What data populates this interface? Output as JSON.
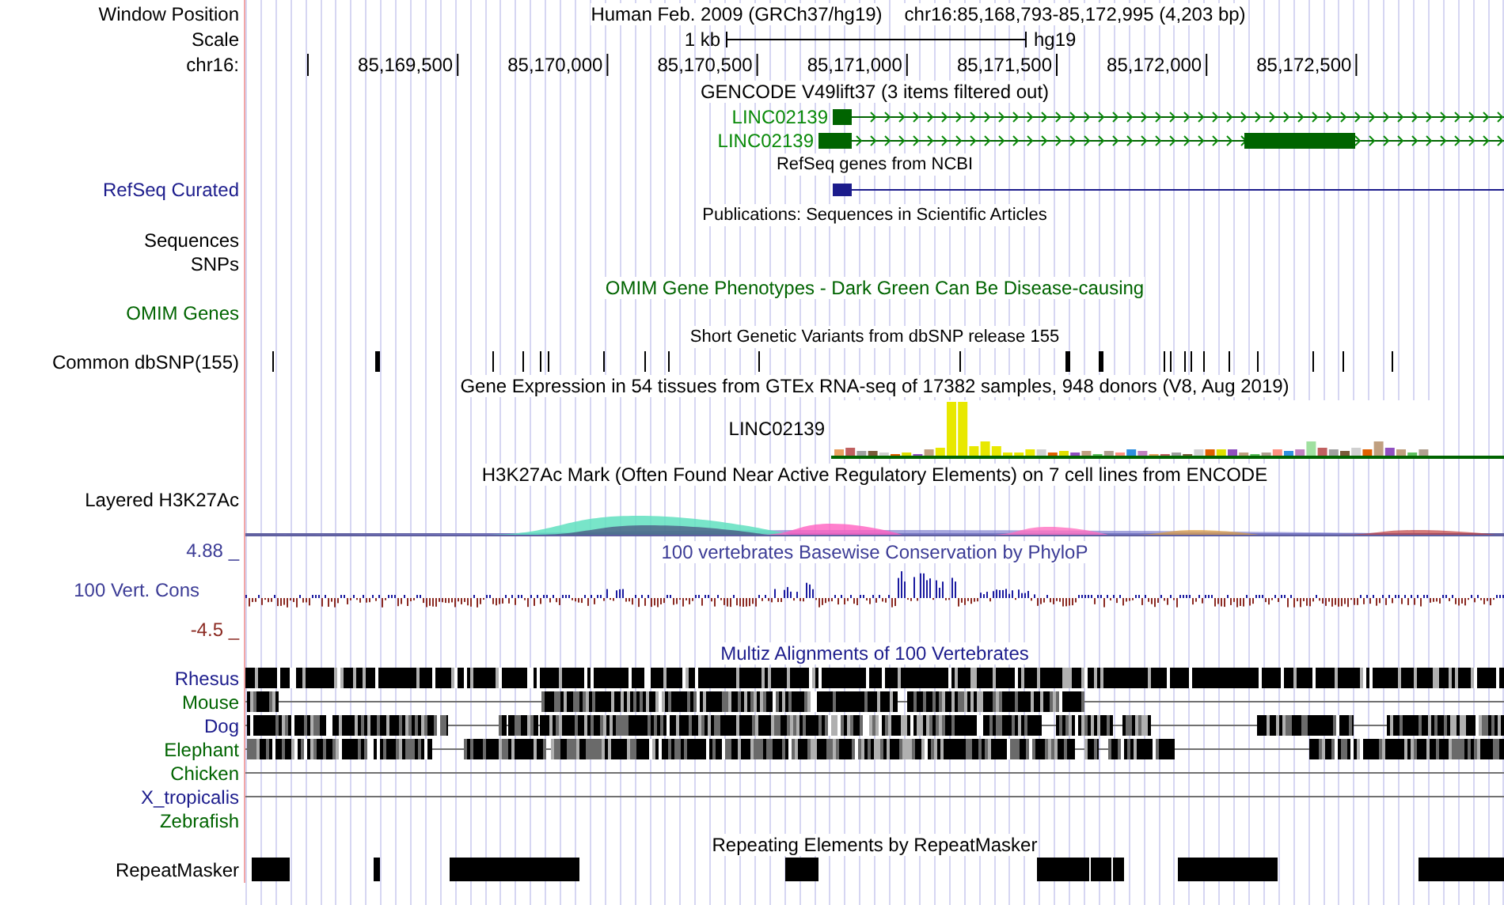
{
  "rows": [
    {
      "kind": "position",
      "label": "Window Position",
      "assembly": "Human Feb. 2009 (GRCh37/hg19)",
      "position": "chr16:85,168,793-85,172,995 (4,203 bp)"
    },
    {
      "kind": "scale",
      "label": "Scale",
      "length": "1 kb",
      "assembly": "hg19"
    },
    {
      "kind": "ruler",
      "label": "chr16:",
      "ticks": [
        "85,169,500",
        "85,170,000",
        "85,170,500",
        "85,171,000",
        "85,171,500",
        "85,172,000",
        "85,172,500"
      ]
    },
    {
      "kind": "title",
      "text": "GENCODE V49lift37 (3 items filtered out)",
      "color": "#000000"
    },
    {
      "kind": "gene",
      "name": "LINC02139"
    },
    {
      "kind": "gene",
      "name": "LINC02139"
    },
    {
      "kind": "title",
      "text": "RefSeq genes from NCBI",
      "color": "#000000",
      "small": true
    },
    {
      "kind": "refseq",
      "label": "RefSeq Curated",
      "color": "#1c1c8c"
    },
    {
      "kind": "title",
      "text": "Publications: Sequences in Scientific Articles",
      "color": "#000000",
      "small": true
    },
    {
      "kind": "label",
      "label": "Sequences",
      "color": "#000000"
    },
    {
      "kind": "label",
      "label": "SNPs",
      "color": "#000000"
    },
    {
      "kind": "title",
      "text": "OMIM Gene Phenotypes - Dark Green Can Be Disease-causing",
      "color": "#006400"
    },
    {
      "kind": "label",
      "label": "OMIM Genes",
      "color": "#006400"
    },
    {
      "kind": "title",
      "text": "Short Genetic Variants from dbSNP release 155",
      "color": "#000000",
      "small": true
    },
    {
      "kind": "snp",
      "label": "Common dbSNP(155)",
      "color": "#000000"
    },
    {
      "kind": "title",
      "text": "Gene Expression in 54 tissues from GTEx RNA-seq of 17382 samples, 948 donors (V8, Aug 2019)",
      "color": "#000000"
    },
    {
      "kind": "expression",
      "gene": "LINC02139"
    },
    {
      "kind": "title",
      "text": "H3K27Ac Mark (Often Found Near Active Regulatory Elements) on 7 cell lines from ENCODE",
      "color": "#000000"
    },
    {
      "kind": "layered",
      "label": "Layered H3K27Ac",
      "color": "#000000"
    },
    {
      "kind": "conservation",
      "label": "100 Vert. Cons",
      "color": "#3c3c96",
      "max": "4.88 _",
      "min": "-4.5 _",
      "title": "100 vertebrates Basewise Conservation by PhyloP"
    },
    {
      "kind": "title",
      "text": "Multiz Alignments of 100 Vertebrates",
      "color": "#1c1c8c"
    },
    {
      "kind": "alignment",
      "label": "Rhesus",
      "color": "#1c1c8c"
    },
    {
      "kind": "alignment",
      "label": "Mouse",
      "color": "#006400"
    },
    {
      "kind": "alignment",
      "label": "Dog",
      "color": "#1c1c8c"
    },
    {
      "kind": "alignment",
      "label": "Elephant",
      "color": "#006400"
    },
    {
      "kind": "alignment",
      "label": "Chicken",
      "color": "#006400"
    },
    {
      "kind": "alignment",
      "label": "X_tropicalis",
      "color": "#1c1c8c"
    },
    {
      "kind": "alignment",
      "label": "Zebrafish",
      "color": "#006400"
    },
    {
      "kind": "title",
      "text": "Repeating Elements by RepeatMasker",
      "color": "#000000"
    },
    {
      "kind": "repeat",
      "label": "RepeatMasker",
      "color": "#000000"
    }
  ]
}
